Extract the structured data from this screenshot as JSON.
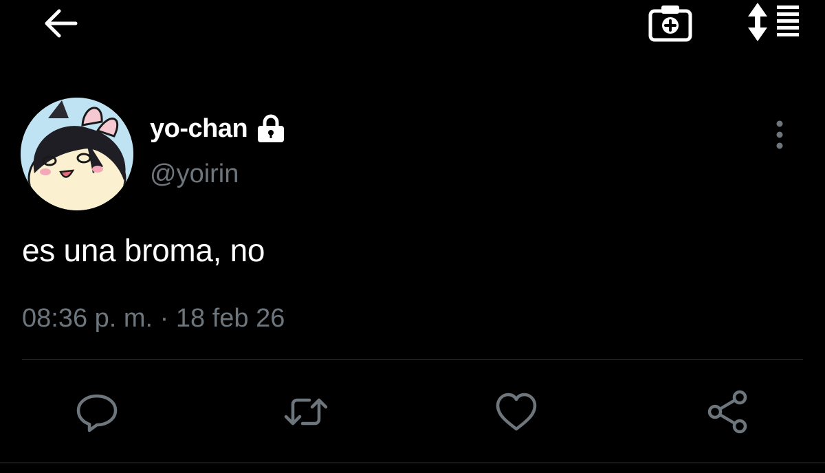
{
  "header": {
    "back_icon": "arrow-left-icon",
    "camera_icon": "camera-plus-icon",
    "sort_icon": "sort-list-icon"
  },
  "tweet": {
    "display_name": "yo-chan",
    "handle": "@yoirin",
    "protected_icon": "lock-icon",
    "text": "es una broma, no",
    "timestamp": "08:36 p. m. · 18 feb 26"
  },
  "actions": [
    {
      "icon": "reply-icon"
    },
    {
      "icon": "retweet-icon"
    },
    {
      "icon": "like-icon"
    },
    {
      "icon": "share-icon"
    }
  ],
  "colors": {
    "background": "#000000",
    "primary_text": "#ffffff",
    "secondary_text": "#6e767d",
    "divider": "#2f3336",
    "icon": "#6e767d"
  }
}
